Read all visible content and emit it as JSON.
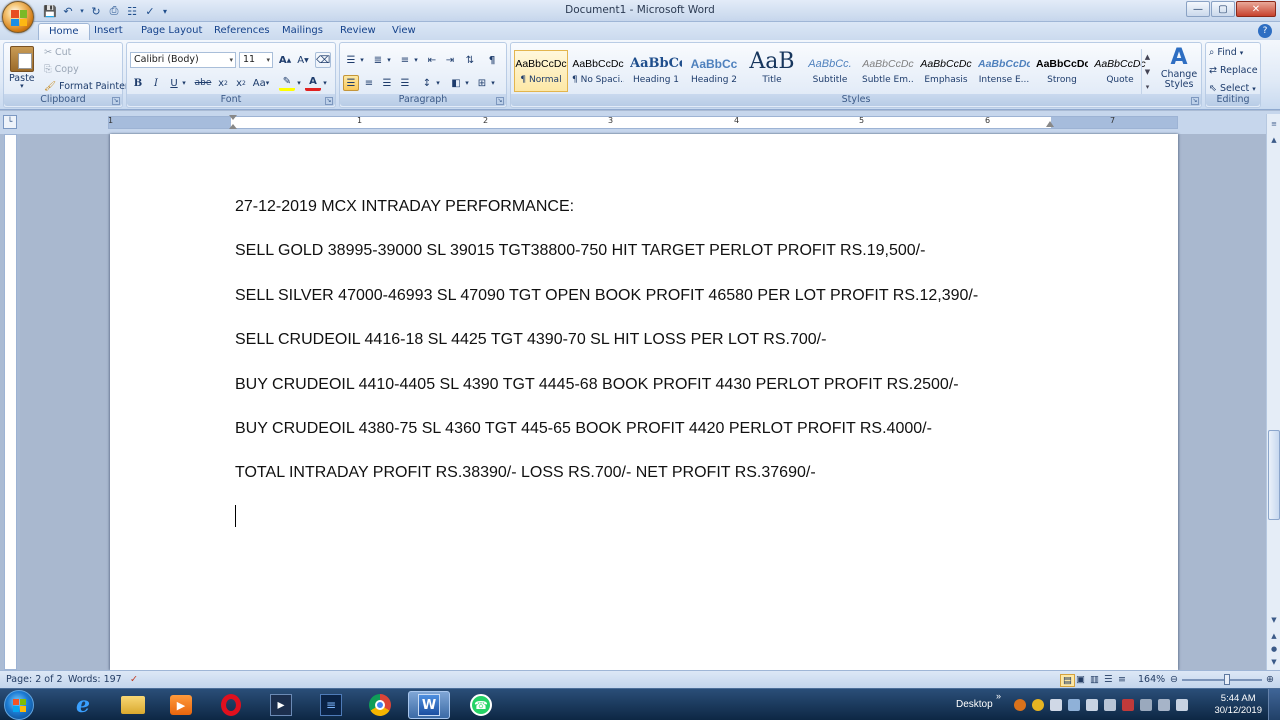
{
  "window": {
    "title": "Document1 - Microsoft Word"
  },
  "tabs": [
    "Home",
    "Insert",
    "Page Layout",
    "References",
    "Mailings",
    "Review",
    "View"
  ],
  "ribbon": {
    "clipboard": {
      "label": "Clipboard",
      "paste": "Paste",
      "cut": "Cut",
      "copy": "Copy",
      "format_painter": "Format Painter"
    },
    "font": {
      "label": "Font",
      "font_name": "Calibri (Body)",
      "font_size": "11"
    },
    "paragraph": {
      "label": "Paragraph"
    },
    "styles": {
      "label": "Styles",
      "gallery": [
        {
          "preview": "AaBbCcDc",
          "name": "¶ Normal"
        },
        {
          "preview": "AaBbCcDc",
          "name": "¶ No Spaci..."
        },
        {
          "preview": "AaBbCc",
          "name": "Heading 1"
        },
        {
          "preview": "AaBbCc",
          "name": "Heading 2"
        },
        {
          "preview": "AaB",
          "name": "Title"
        },
        {
          "preview": "AaBbCc.",
          "name": "Subtitle"
        },
        {
          "preview": "AaBbCcDc",
          "name": "Subtle Em..."
        },
        {
          "preview": "AaBbCcDc",
          "name": "Emphasis"
        },
        {
          "preview": "AaBbCcDc",
          "name": "Intense E..."
        },
        {
          "preview": "AaBbCcDc",
          "name": "Strong"
        },
        {
          "preview": "AaBbCcDc",
          "name": "Quote"
        }
      ],
      "change_styles": "Change Styles"
    },
    "editing": {
      "label": "Editing",
      "find": "Find",
      "replace": "Replace",
      "select": "Select"
    }
  },
  "ruler": {
    "numbers": [
      "1",
      "1",
      "2",
      "3",
      "4",
      "5",
      "6",
      "7"
    ]
  },
  "document": {
    "paragraphs": [
      "27-12-2019 MCX INTRADAY PERFORMANCE:",
      "SELL GOLD 38995-39000 SL 39015 TGT38800-750 HIT TARGET PERLOT PROFIT RS.19,500/-",
      "SELL SILVER  47000-46993 SL 47090 TGT OPEN BOOK PROFIT 46580 PER LOT PROFIT RS.12,390/-",
      "SELL CRUDEOIL 4416-18 SL 4425 TGT 4390-70 SL HIT LOSS PER LOT RS.700/-",
      "BUY CRUDEOIL  4410-4405 SL 4390 TGT 4445-68 BOOK PROFIT 4430 PERLOT PROFIT RS.2500/-",
      "BUY CRUDEOIL 4380-75 SL 4360 TGT 445-65 BOOK PROFIT 4420 PERLOT PROFIT RS.4000/-",
      "TOTAL INTRADAY PROFIT RS.38390/- LOSS RS.700/- NET PROFIT RS.37690/-"
    ]
  },
  "status": {
    "page": "Page: 2 of 2",
    "words": "Words: 197",
    "zoom": "164%"
  },
  "taskbar": {
    "desktop": "Desktop",
    "time": "5:44 AM",
    "date": "30/12/2019"
  }
}
